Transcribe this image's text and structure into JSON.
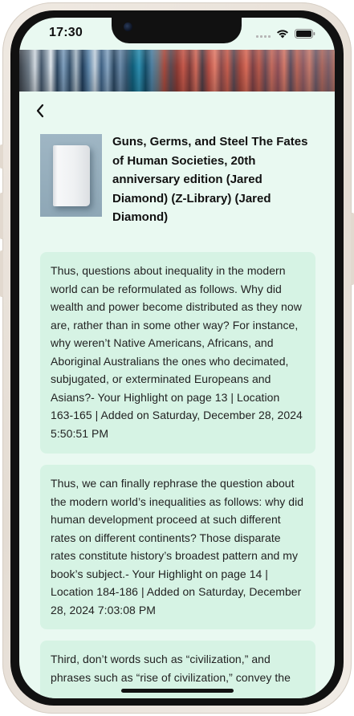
{
  "status_bar": {
    "time": "17:30",
    "icons": [
      "signal-icon",
      "wifi-icon",
      "battery-icon"
    ]
  },
  "nav": {
    "back_icon": "chevron-left-icon"
  },
  "book": {
    "title": "Guns, Germs, and Steel The Fates of Human Societies, 20th anniversary edition (Jared Diamond) (Z-Library) (Jared Diamond)",
    "cover_icon": "book-icon"
  },
  "highlights": [
    {
      "text": "Thus, questions about inequality in the modern world can be reformulated as follows. Why did wealth and power become distributed as they now are, rather than in some other way? For instance, why weren’t Native Americans, Africans, and Aboriginal Australians the ones who decimated, subjugated, or exterminated Europeans and Asians?- Your Highlight on page 13 | Location 163-165 | Added on Saturday, December 28, 2024 5:50:51 PM"
    },
    {
      "text": "Thus, we can finally rephrase the question about the modern world’s inequalities as follows: why did human development proceed at such different rates on different continents? Those disparate rates constitute history’s broadest pattern and my book’s subject.- Your Highlight on page 14 | Location 184-186 | Added on Saturday, December 28, 2024 7:03:08 PM"
    },
    {
      "text": "Third, don’t words such as “civilization,” and phrases such as “rise of civilization,” convey the"
    }
  ],
  "colors": {
    "screen_background": "#e9f9f1",
    "card_background": "#d6f3e4",
    "text": "#222222"
  }
}
